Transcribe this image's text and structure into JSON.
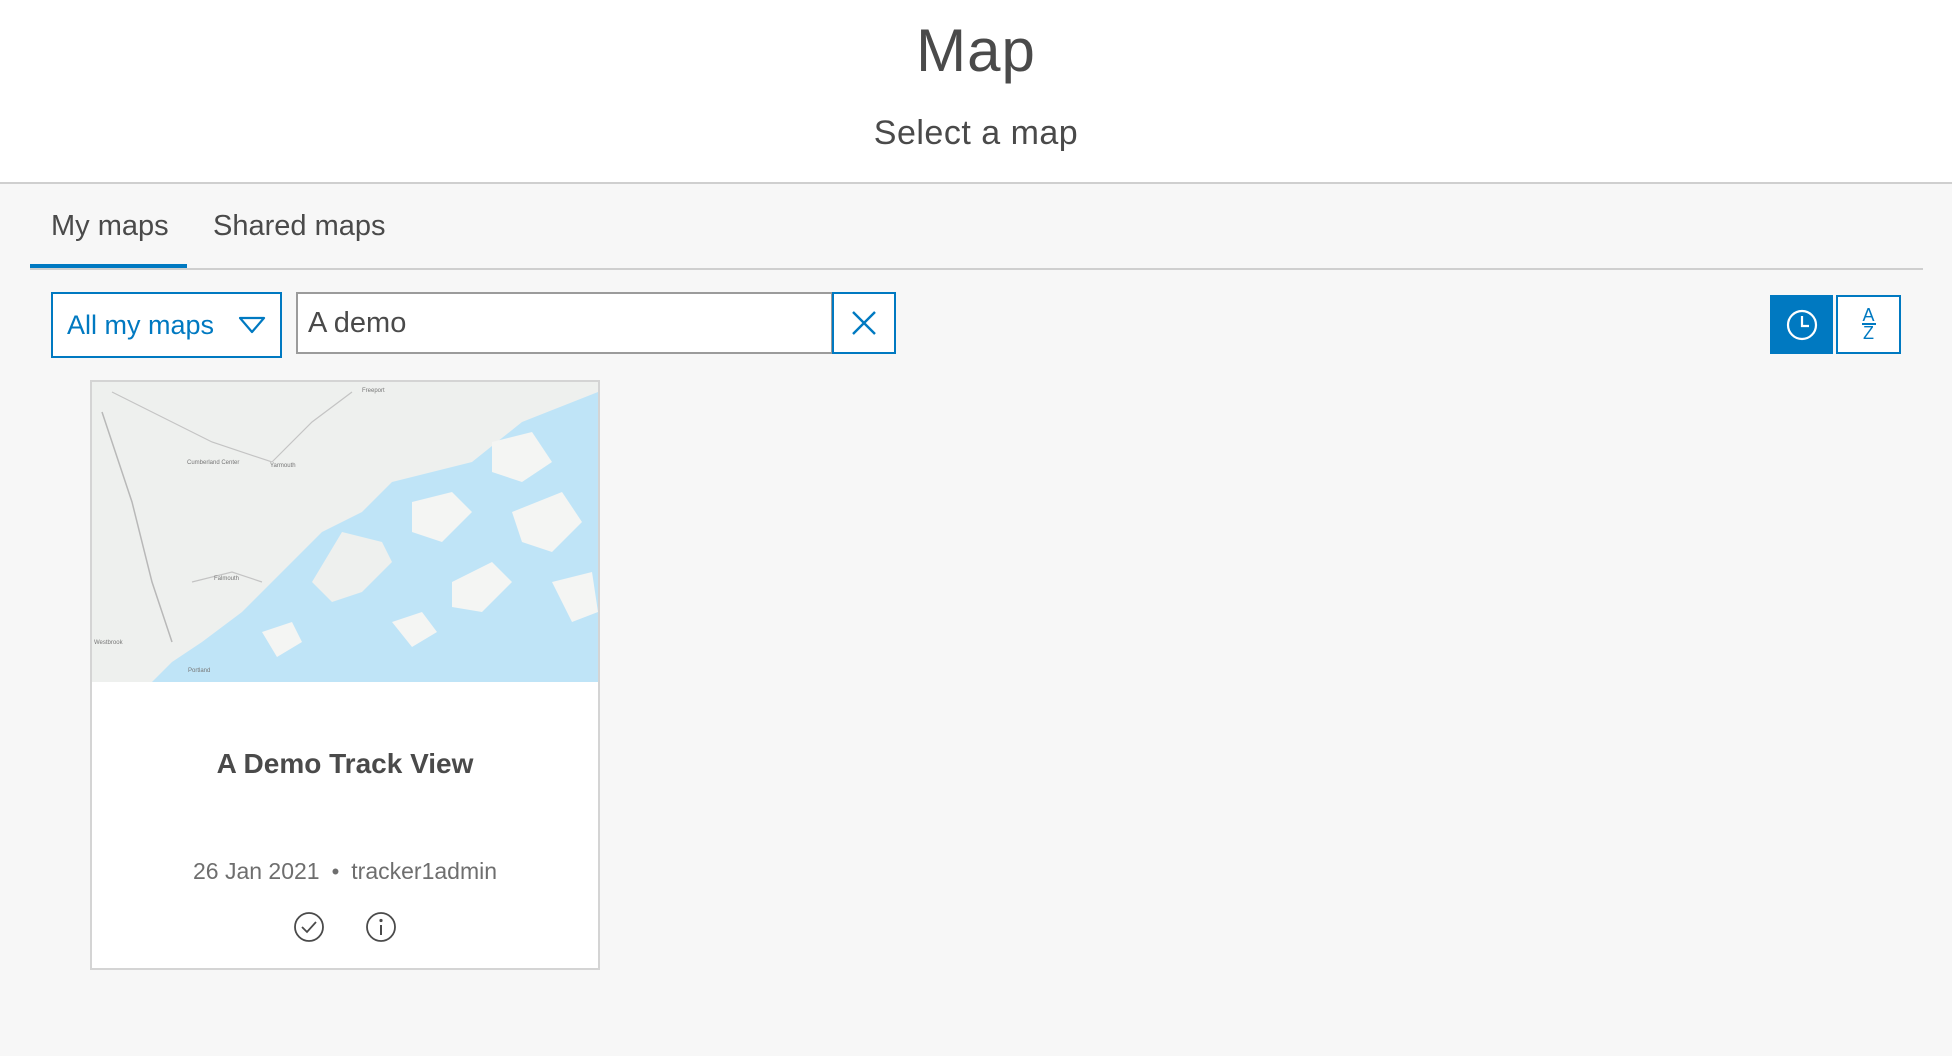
{
  "header": {
    "title": "Map",
    "subtitle": "Select a map"
  },
  "tabs": [
    {
      "label": "My maps",
      "active": true
    },
    {
      "label": "Shared maps",
      "active": false
    }
  ],
  "toolbar": {
    "filter_value": "All my maps",
    "search_value": "A demo",
    "sort_alpha_label_top": "A",
    "sort_alpha_label_bottom": "Z",
    "active_sort": "date"
  },
  "cards": [
    {
      "title": "A Demo Track View",
      "date": "26 Jan 2021",
      "owner": "tracker1admin",
      "thumbnail_labels": [
        "Freeport",
        "Cumberland Center",
        "Yarmouth",
        "Falmouth",
        "Westbrook",
        "Portland"
      ]
    }
  ],
  "colors": {
    "accent": "#0079c1",
    "text": "#4a4a4a",
    "background": "#f7f7f7",
    "water": "#bfe4f7",
    "land": "#eef0ee"
  }
}
